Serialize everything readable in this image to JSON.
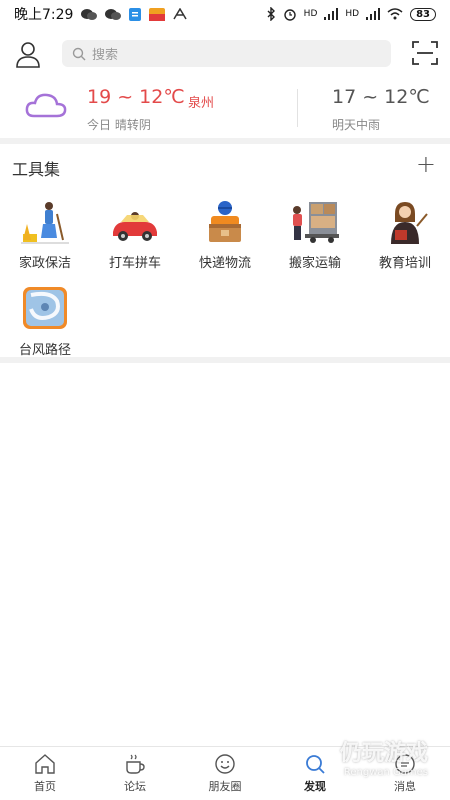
{
  "status_bar": {
    "time": "晚上7:29",
    "hd1": "HD",
    "hd2": "HD",
    "battery": "83"
  },
  "header": {
    "search_placeholder": "搜索"
  },
  "weather": {
    "today_temp": "19 ~ 12℃",
    "city": "泉州",
    "today_desc": "今日 晴转阴",
    "tomorrow_temp": "17 ~ 12℃",
    "tomorrow_desc": "明天中雨"
  },
  "tools": {
    "title": "工具集",
    "add": "+",
    "items": [
      {
        "label": "家政保洁",
        "icon": "cleaning-icon"
      },
      {
        "label": "打车拼车",
        "icon": "car-icon"
      },
      {
        "label": "快递物流",
        "icon": "delivery-icon"
      },
      {
        "label": "搬家运输",
        "icon": "moving-truck-icon"
      },
      {
        "label": "教育培训",
        "icon": "teacher-icon"
      },
      {
        "label": "台风路径",
        "icon": "typhoon-icon"
      }
    ]
  },
  "nav": {
    "items": [
      {
        "label": "首页",
        "icon": "home-icon"
      },
      {
        "label": "论坛",
        "icon": "coffee-icon"
      },
      {
        "label": "朋友圈",
        "icon": "smile-icon"
      },
      {
        "label": "发现",
        "icon": "discover-icon"
      },
      {
        "label": "消息",
        "icon": "message-icon"
      }
    ],
    "active_index": 3
  },
  "watermark": {
    "text": "仍玩游戏",
    "sub": "Rengwan Games"
  }
}
